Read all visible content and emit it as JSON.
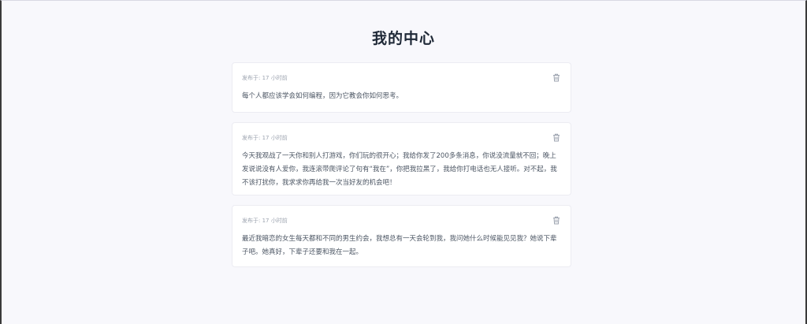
{
  "page": {
    "title": "我的中心"
  },
  "posts": [
    {
      "meta": "发布于: 17 小时前",
      "body": "每个人都应该学会如何编程，因为它教会你如何思考。",
      "delete_icon": "trash-icon"
    },
    {
      "meta": "发布于: 17 小时前",
      "body": "今天我观战了一天你和别人打游戏，你们玩的很开心；我给你发了200多条消息，你说没流量就不回；晚上发说说没有人爱你，我连滚带爬评论了句有“我在”，你把我拉黑了，我给你打电话也无人接听。对不起，我不该打扰你，我求求你再给我一次当好友的机会吧！",
      "delete_icon": "trash-icon"
    },
    {
      "meta": "发布于: 17 小时前",
      "body": "最近我暗恋的女生每天都和不同的男生约会，我想总有一天会轮到我，我问她什么时候能见见我？她说下辈子吧。她真好，下辈子还要和我在一起。",
      "delete_icon": "trash-icon"
    }
  ],
  "colors": {
    "background": "#f8f8fc",
    "card": "#ffffff",
    "title": "#1f2937",
    "body_text": "#4b5563",
    "meta_text": "#9ca3af",
    "icon": "#9ca3af"
  }
}
